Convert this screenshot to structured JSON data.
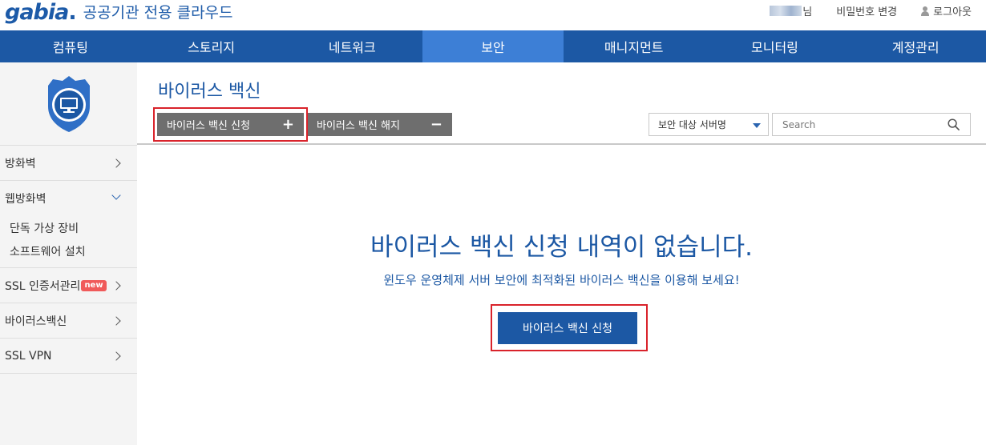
{
  "header": {
    "logo_word": "gabia",
    "logo_subtitle": "공공기관 전용 클라우드",
    "user_suffix": "님",
    "change_password": "비밀번호 변경",
    "logout": "로그아웃"
  },
  "nav": {
    "items": [
      {
        "label": "컴퓨팅"
      },
      {
        "label": "스토리지"
      },
      {
        "label": "네트워크"
      },
      {
        "label": "보안"
      },
      {
        "label": "매니지먼트"
      },
      {
        "label": "모니터링"
      },
      {
        "label": "계정관리"
      }
    ],
    "active_index": 3
  },
  "sidebar": {
    "items": [
      {
        "label": "방화벽"
      },
      {
        "label": "웹방화벽"
      },
      {
        "label": "단독 가상 장비"
      },
      {
        "label": "소프트웨어 설치"
      },
      {
        "label": "SSL 인증서관리",
        "badge": "new"
      },
      {
        "label": "바이러스백신"
      },
      {
        "label": "SSL VPN"
      }
    ]
  },
  "main": {
    "title": "바이러스 백신",
    "apply_button": "바이러스 백신 신청",
    "apply_sign": "+",
    "cancel_button": "바이러스 백신 해지",
    "cancel_sign": "−",
    "select_value": "보안 대상 서버명",
    "search_placeholder": "Search",
    "empty_title": "바이러스 백신 신청 내역이 없습니다.",
    "empty_subtitle": "윈도우 운영체제 서버 보안에 최적화된 바이러스 백신을 이용해 보세요!",
    "cta_button": "바이러스 백신 신청"
  },
  "colors": {
    "brand": "#1c58a4",
    "nav_active": "#3d7fd6",
    "highlight": "#d9232b",
    "button_gray": "#6e6e6e",
    "badge_new": "#f05a5a"
  }
}
